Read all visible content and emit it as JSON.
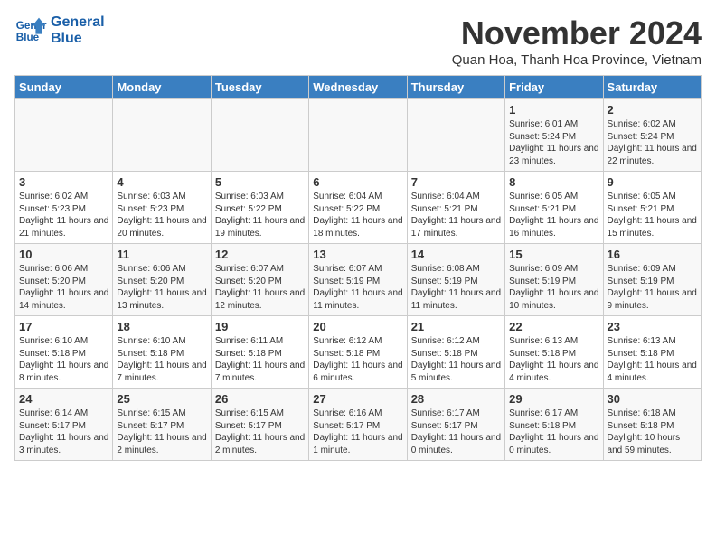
{
  "header": {
    "logo_line1": "General",
    "logo_line2": "Blue",
    "month": "November 2024",
    "location": "Quan Hoa, Thanh Hoa Province, Vietnam"
  },
  "days_of_week": [
    "Sunday",
    "Monday",
    "Tuesday",
    "Wednesday",
    "Thursday",
    "Friday",
    "Saturday"
  ],
  "weeks": [
    [
      {
        "day": "",
        "info": ""
      },
      {
        "day": "",
        "info": ""
      },
      {
        "day": "",
        "info": ""
      },
      {
        "day": "",
        "info": ""
      },
      {
        "day": "",
        "info": ""
      },
      {
        "day": "1",
        "info": "Sunrise: 6:01 AM\nSunset: 5:24 PM\nDaylight: 11 hours and 23 minutes."
      },
      {
        "day": "2",
        "info": "Sunrise: 6:02 AM\nSunset: 5:24 PM\nDaylight: 11 hours and 22 minutes."
      }
    ],
    [
      {
        "day": "3",
        "info": "Sunrise: 6:02 AM\nSunset: 5:23 PM\nDaylight: 11 hours and 21 minutes."
      },
      {
        "day": "4",
        "info": "Sunrise: 6:03 AM\nSunset: 5:23 PM\nDaylight: 11 hours and 20 minutes."
      },
      {
        "day": "5",
        "info": "Sunrise: 6:03 AM\nSunset: 5:22 PM\nDaylight: 11 hours and 19 minutes."
      },
      {
        "day": "6",
        "info": "Sunrise: 6:04 AM\nSunset: 5:22 PM\nDaylight: 11 hours and 18 minutes."
      },
      {
        "day": "7",
        "info": "Sunrise: 6:04 AM\nSunset: 5:21 PM\nDaylight: 11 hours and 17 minutes."
      },
      {
        "day": "8",
        "info": "Sunrise: 6:05 AM\nSunset: 5:21 PM\nDaylight: 11 hours and 16 minutes."
      },
      {
        "day": "9",
        "info": "Sunrise: 6:05 AM\nSunset: 5:21 PM\nDaylight: 11 hours and 15 minutes."
      }
    ],
    [
      {
        "day": "10",
        "info": "Sunrise: 6:06 AM\nSunset: 5:20 PM\nDaylight: 11 hours and 14 minutes."
      },
      {
        "day": "11",
        "info": "Sunrise: 6:06 AM\nSunset: 5:20 PM\nDaylight: 11 hours and 13 minutes."
      },
      {
        "day": "12",
        "info": "Sunrise: 6:07 AM\nSunset: 5:20 PM\nDaylight: 11 hours and 12 minutes."
      },
      {
        "day": "13",
        "info": "Sunrise: 6:07 AM\nSunset: 5:19 PM\nDaylight: 11 hours and 11 minutes."
      },
      {
        "day": "14",
        "info": "Sunrise: 6:08 AM\nSunset: 5:19 PM\nDaylight: 11 hours and 11 minutes."
      },
      {
        "day": "15",
        "info": "Sunrise: 6:09 AM\nSunset: 5:19 PM\nDaylight: 11 hours and 10 minutes."
      },
      {
        "day": "16",
        "info": "Sunrise: 6:09 AM\nSunset: 5:19 PM\nDaylight: 11 hours and 9 minutes."
      }
    ],
    [
      {
        "day": "17",
        "info": "Sunrise: 6:10 AM\nSunset: 5:18 PM\nDaylight: 11 hours and 8 minutes."
      },
      {
        "day": "18",
        "info": "Sunrise: 6:10 AM\nSunset: 5:18 PM\nDaylight: 11 hours and 7 minutes."
      },
      {
        "day": "19",
        "info": "Sunrise: 6:11 AM\nSunset: 5:18 PM\nDaylight: 11 hours and 7 minutes."
      },
      {
        "day": "20",
        "info": "Sunrise: 6:12 AM\nSunset: 5:18 PM\nDaylight: 11 hours and 6 minutes."
      },
      {
        "day": "21",
        "info": "Sunrise: 6:12 AM\nSunset: 5:18 PM\nDaylight: 11 hours and 5 minutes."
      },
      {
        "day": "22",
        "info": "Sunrise: 6:13 AM\nSunset: 5:18 PM\nDaylight: 11 hours and 4 minutes."
      },
      {
        "day": "23",
        "info": "Sunrise: 6:13 AM\nSunset: 5:18 PM\nDaylight: 11 hours and 4 minutes."
      }
    ],
    [
      {
        "day": "24",
        "info": "Sunrise: 6:14 AM\nSunset: 5:17 PM\nDaylight: 11 hours and 3 minutes."
      },
      {
        "day": "25",
        "info": "Sunrise: 6:15 AM\nSunset: 5:17 PM\nDaylight: 11 hours and 2 minutes."
      },
      {
        "day": "26",
        "info": "Sunrise: 6:15 AM\nSunset: 5:17 PM\nDaylight: 11 hours and 2 minutes."
      },
      {
        "day": "27",
        "info": "Sunrise: 6:16 AM\nSunset: 5:17 PM\nDaylight: 11 hours and 1 minute."
      },
      {
        "day": "28",
        "info": "Sunrise: 6:17 AM\nSunset: 5:17 PM\nDaylight: 11 hours and 0 minutes."
      },
      {
        "day": "29",
        "info": "Sunrise: 6:17 AM\nSunset: 5:18 PM\nDaylight: 11 hours and 0 minutes."
      },
      {
        "day": "30",
        "info": "Sunrise: 6:18 AM\nSunset: 5:18 PM\nDaylight: 10 hours and 59 minutes."
      }
    ]
  ]
}
